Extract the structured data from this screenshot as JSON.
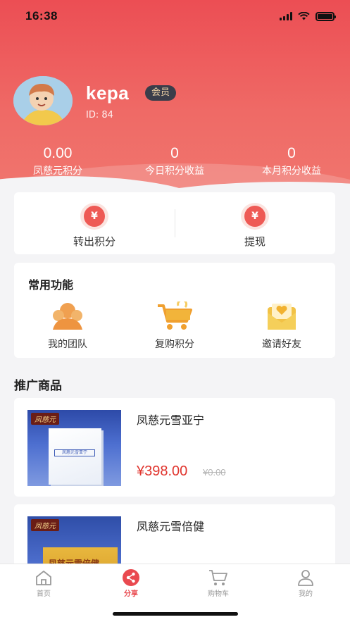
{
  "status_bar": {
    "time": "16:38"
  },
  "profile": {
    "name": "kepa",
    "badge": "会员",
    "id_text": "ID: 84"
  },
  "stats": [
    {
      "value": "0.00",
      "label": "凤慈元积分"
    },
    {
      "value": "0",
      "label": "今日积分收益"
    },
    {
      "value": "0",
      "label": "本月积分收益"
    }
  ],
  "quick_actions": [
    {
      "icon": "yen-coin-icon",
      "label": "转出积分"
    },
    {
      "icon": "yen-coin-icon",
      "label": "提现"
    }
  ],
  "functions": {
    "title": "常用功能",
    "items": [
      {
        "icon": "team-icon",
        "label": "我的团队"
      },
      {
        "icon": "cart-icon",
        "label": "复购积分"
      },
      {
        "icon": "invite-envelope-icon",
        "label": "邀请好友"
      }
    ]
  },
  "promo": {
    "title": "推广商品",
    "products": [
      {
        "name": "凤慈元雪亚宁",
        "price": "¥398.00",
        "original_price": "¥0.00",
        "image_logo": "凤慈元",
        "image_box_text": "凤慈元雪亚宁"
      },
      {
        "name": "凤慈元雪倍健",
        "image_logo": "凤慈元",
        "image_box_text": "凤慈元雪倍健"
      }
    ]
  },
  "tab_bar": {
    "tabs": [
      {
        "icon": "home-icon",
        "label": "首页"
      },
      {
        "icon": "share-icon",
        "label": "分享",
        "active": true
      },
      {
        "icon": "shopping-cart-icon",
        "label": "购物车"
      },
      {
        "icon": "user-icon",
        "label": "我的"
      }
    ]
  },
  "colors": {
    "accent": "#e9494f",
    "header_gradient_top": "#ec4e54",
    "header_gradient_bottom": "#f0776f",
    "price": "#e0342d",
    "badge_bg": "#3a3d4a",
    "icon_orange": "#f0a050",
    "icon_gold": "#f2c246"
  }
}
